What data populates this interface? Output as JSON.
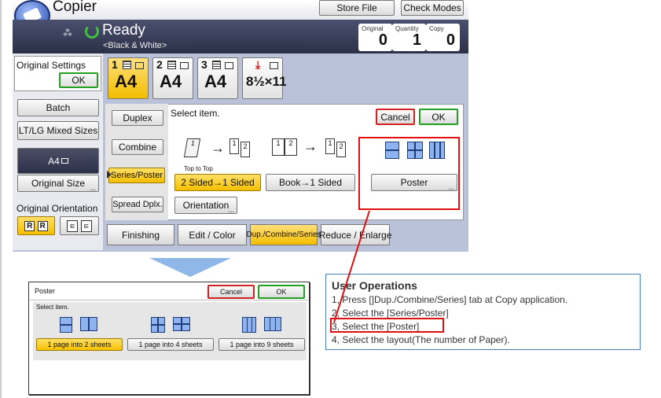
{
  "app": {
    "title": "Copier",
    "store_file": "Store File",
    "check_modes": "Check Modes"
  },
  "status": {
    "ready": "Ready",
    "mode": "<Black & White>"
  },
  "counters": [
    {
      "label": "Original",
      "value": "0"
    },
    {
      "label": "Quantity",
      "value": "1"
    },
    {
      "label": "Copy",
      "value": "0"
    }
  ],
  "paper_trays": [
    {
      "num": "1",
      "size": "A4"
    },
    {
      "num": "2",
      "size": "A4"
    },
    {
      "num": "3",
      "size": "A4"
    },
    {
      "num": "",
      "size": "8½×11"
    }
  ],
  "left": {
    "original_settings": "Original Settings",
    "ok": "OK",
    "batch": "Batch",
    "ltlg": "LT/LG Mixed Sizes",
    "a4": "A4",
    "original_size": "Original Size",
    "orientation": "Original Orientation"
  },
  "menu": {
    "duplex": "Duplex",
    "combine": "Combine",
    "series_poster": "Series/Poster",
    "spread": "Spread Dplx."
  },
  "panel": {
    "select_item": "Select item.",
    "cancel": "Cancel",
    "ok": "OK",
    "top_to_top": "Top to Top",
    "two_sided": "2 Sided→1 Sided",
    "book": "Book→1 Sided",
    "poster": "Poster",
    "orientation": "Orientation"
  },
  "bottom_tabs": [
    "Finishing",
    "Edit / Color",
    "Dup./Combine/Series",
    "Reduce / Enlarge"
  ],
  "poster_dialog": {
    "title": "Poster",
    "cancel": "Cancel",
    "ok": "OK",
    "select_item": "Select item.",
    "options": [
      "1 page into 2 sheets",
      "1 page into 4 sheets",
      "1 page into 9 sheets"
    ]
  },
  "user_ops": {
    "title": "User Operations",
    "steps": [
      "1, Press []Dup./Combine/Series] tab at Copy application.",
      "2, Select the [Series/Poster]",
      "3, Select the [Poster]",
      "4, Select the layout(The number of Paper)."
    ]
  },
  "colors": {
    "accent": "#f5c000",
    "highlight": "#e01010",
    "header_bg": "#3a3f5c"
  }
}
